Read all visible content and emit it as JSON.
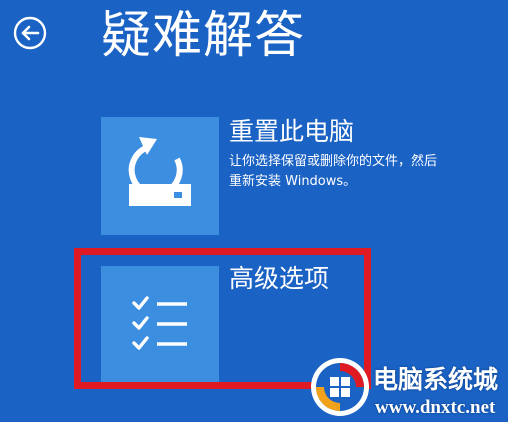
{
  "header": {
    "back_icon": "arrow-left-circle-icon",
    "title": "疑难解答"
  },
  "options": [
    {
      "icon": "reset-pc-icon",
      "title": "重置此电脑",
      "description_lines": [
        "让你选择保留或删除你的文件，然后",
        "重新安装 Windows。"
      ]
    },
    {
      "icon": "checklist-icon",
      "title": "高级选项",
      "highlighted": true
    }
  ],
  "watermark": {
    "logo_icon": "site-logo-icon",
    "name": "电脑系统城",
    "url": "www.dnxtc.net"
  },
  "colors": {
    "background": "#1a62c4",
    "tile": "#3c8ee0",
    "highlight_border": "#e01a22",
    "text": "#ffffff"
  }
}
